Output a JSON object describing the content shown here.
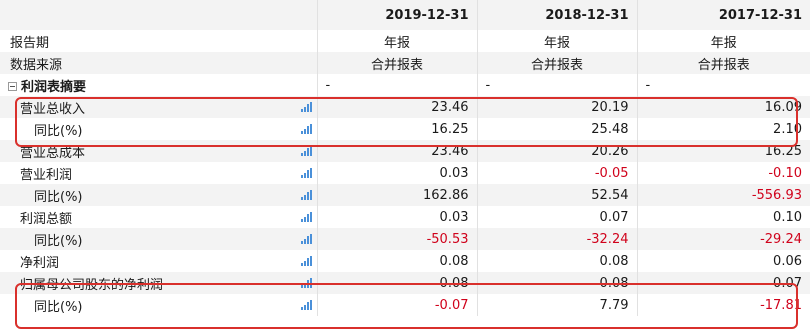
{
  "columns": [
    "2019-12-31",
    "2018-12-31",
    "2017-12-31"
  ],
  "meta_rows": [
    {
      "label": "报告期",
      "values": [
        "年报",
        "年报",
        "年报"
      ]
    },
    {
      "label": "数据来源",
      "values": [
        "合并报表",
        "合并报表",
        "合并报表"
      ]
    }
  ],
  "section": {
    "label": "利润表摘要",
    "values": [
      "-",
      "-",
      "-"
    ]
  },
  "rows": [
    {
      "label": "营业总收入",
      "values": [
        "23.46",
        "20.19",
        "16.09"
      ]
    },
    {
      "label": "同比(%)",
      "values": [
        "16.25",
        "25.48",
        "2.10"
      ]
    },
    {
      "label": "营业总成本",
      "values": [
        "23.46",
        "20.26",
        "16.25"
      ]
    },
    {
      "label": "营业利润",
      "values": [
        "0.03",
        "-0.05",
        "-0.10"
      ]
    },
    {
      "label": "同比(%)",
      "values": [
        "162.86",
        "52.54",
        "-556.93"
      ]
    },
    {
      "label": "利润总额",
      "values": [
        "0.03",
        "0.07",
        "0.10"
      ]
    },
    {
      "label": "同比(%)",
      "values": [
        "-50.53",
        "-32.24",
        "-29.24"
      ]
    },
    {
      "label": "净利润",
      "values": [
        "0.08",
        "0.08",
        "0.06"
      ]
    },
    {
      "label": "归属母公司股东的净利润",
      "values": [
        "0.08",
        "0.08",
        "0.07"
      ]
    },
    {
      "label": "同比(%)",
      "values": [
        "-0.07",
        "7.79",
        "-17.81"
      ]
    }
  ],
  "icons": {
    "chart": "bar-chart-icon",
    "collapse": "collapse-minus-icon"
  },
  "colors": {
    "negative": "#d0021b",
    "highlight_box": "#d9302c",
    "chart_icon": "#4a90d9",
    "stripe": "#f3f3f3"
  }
}
